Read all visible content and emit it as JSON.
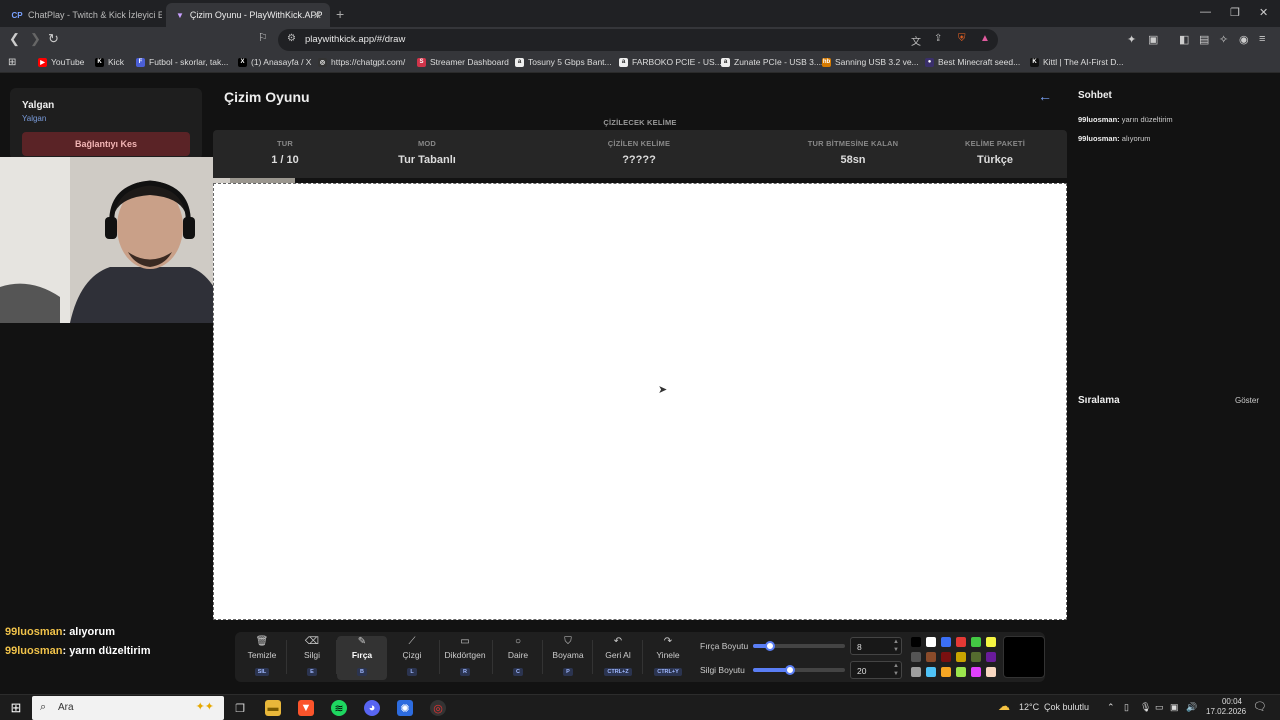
{
  "browser": {
    "tabs": [
      {
        "label": "ChatPlay - Twitch & Kick İzleyici Etki",
        "fav": "CP",
        "active": false
      },
      {
        "label": "Çizim Oyunu - PlayWithKick.APP",
        "fav": "▼",
        "active": true
      }
    ],
    "url": "playwithkick.app/#/draw",
    "bookmarks": [
      {
        "label": "YouTube",
        "color": "#ff0000",
        "glyph": "▶"
      },
      {
        "label": "Kick",
        "color": "#000000",
        "glyph": "K"
      },
      {
        "label": "Futbol - skorlar, tak...",
        "color": "#4b5fd6",
        "glyph": "F"
      },
      {
        "label": "(1) Anasayfa / X",
        "color": "#000000",
        "glyph": "X"
      },
      {
        "label": "https://chatgpt.com/",
        "color": "#333333",
        "glyph": "◎"
      },
      {
        "label": "Streamer Dashboard",
        "color": "#d0344a",
        "glyph": "S"
      },
      {
        "label": "Tosuny 5 Gbps Bant...",
        "color": "#eeeeee",
        "glyph": "a"
      },
      {
        "label": "FARBOKO PCIE - US...",
        "color": "#eeeeee",
        "glyph": "a"
      },
      {
        "label": "Zunate PCIe - USB 3....",
        "color": "#eeeeee",
        "glyph": "a"
      },
      {
        "label": "Sanning USB 3.2 ve...",
        "color": "#d67a00",
        "glyph": "hb"
      },
      {
        "label": "Best Minecraft seed...",
        "color": "#3a2f6b",
        "glyph": "●"
      },
      {
        "label": "Kittl | The AI-First D...",
        "color": "#111111",
        "glyph": "K"
      }
    ]
  },
  "sidebar": {
    "user_name": "Yalgan",
    "user_link": "Yalgan",
    "disconnect_label": "Bağlantıyı Kes"
  },
  "overlay_chat": [
    {
      "user": "99luosman",
      "msg": ": alıyorum"
    },
    {
      "user": "99luosman",
      "msg": ": yarın düzeltirim"
    }
  ],
  "game": {
    "title": "Çizim Oyunu",
    "word_caption": "ÇİZİLECEK KELİME",
    "info": [
      {
        "label": "TUR",
        "value": "1 / 10"
      },
      {
        "label": "MOD",
        "value": "Tur Tabanlı"
      },
      {
        "label": "ÇİZİLEN KELİME",
        "value": "?????"
      },
      {
        "label": "TUR BİTMESİNE KALAN",
        "value": "58sn"
      },
      {
        "label": "KELİME PAKETİ",
        "value": "Türkçe"
      }
    ]
  },
  "tools": [
    {
      "name": "Temizle",
      "key": "SIL",
      "icon": "🗑"
    },
    {
      "name": "Silgi",
      "key": "E",
      "icon": "⌫"
    },
    {
      "name": "Fırça",
      "key": "B",
      "icon": "✎",
      "active": true
    },
    {
      "name": "Çizgi",
      "key": "L",
      "icon": "⟋"
    },
    {
      "name": "Dikdörtgen",
      "key": "R",
      "icon": "▭"
    },
    {
      "name": "Daire",
      "key": "C",
      "icon": "○"
    },
    {
      "name": "Boyama",
      "key": "P",
      "icon": "⛉"
    },
    {
      "name": "Geri Al",
      "key": "CTRL+Z",
      "icon": "↶"
    },
    {
      "name": "Yinele",
      "key": "CTRL+Y",
      "icon": "↷"
    }
  ],
  "sliders": {
    "brush_label": "Fırça Boyutu",
    "brush_value": "8",
    "brush_fraction": 0.18,
    "eraser_label": "Silgi Boyutu",
    "eraser_value": "20",
    "eraser_fraction": 0.4
  },
  "palette": [
    "#000000",
    "#ffffff",
    "#3b6ff5",
    "#e53935",
    "#43c943",
    "#f5f542",
    "#555555",
    "#8a4b2a",
    "#7a1010",
    "#c9a400",
    "#556b2f",
    "#6a1b9a",
    "#9e9e9e",
    "#4fc3f7",
    "#f5a623",
    "#9be64d",
    "#e040fb",
    "#f8d7c0"
  ],
  "current_color": "#000000",
  "chat": {
    "title": "Sohbet",
    "messages": [
      {
        "user": "99luosman:",
        "msg": "yarın düzeltirim"
      },
      {
        "user": "99luosman:",
        "msg": "alıyorum"
      }
    ]
  },
  "ranking": {
    "title": "Sıralama",
    "show_label": "Göster"
  },
  "taskbar": {
    "search_placeholder": "Ara",
    "weather": "12°C",
    "weather_desc": "Çok bulutlu",
    "time": "00:04",
    "date": "17.02.2026"
  }
}
